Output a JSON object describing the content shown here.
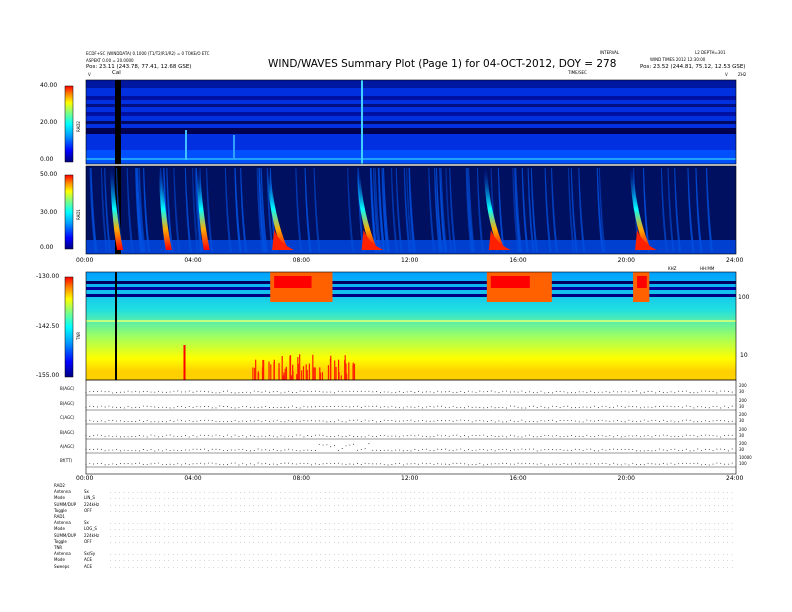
{
  "header": {
    "title": "WIND/WAVES Summary Plot (Page 1) for 04-OCT-2012, DOY = 278",
    "left_line1": "ECDF+SC (WINDDATA) 0.1000 (T1/T2/R1/R2) = 0 TOKE/O ETC",
    "left_line2": "ASPEKT 0.00 = 20.0000",
    "left_line3": "Pos: 23.11 (243.78, 77.41, 12.68 GSE)",
    "center_mark": "Cal",
    "left_v": "V",
    "right_v": "V",
    "right_line1": "INTERVAL",
    "right_line2": "WIND TIMES 2012 12:30:00",
    "right_line3": "Pos: 23.52 (244.81, 75.12, 12.53 GSE)",
    "right_top": "L2 DEPTH=301",
    "right_corner": "ZH2",
    "time_unit": "TIME/SEC"
  },
  "panels": {
    "rad2": {
      "label": "RAD2",
      "ticks": [
        "40.00",
        "20.00",
        "0.00"
      ]
    },
    "rad1": {
      "label": "RAD1",
      "ticks": [
        "50.00",
        "30.00",
        "0.00"
      ]
    },
    "tnr": {
      "label": "TNR",
      "ticks": [
        "-130.00",
        "-142.50",
        "-155.00"
      ],
      "right_ticks": [
        "100",
        "10"
      ],
      "right_unit": "KHZ"
    },
    "time_axis": [
      "00:00",
      "04:00",
      "08:00",
      "12:00",
      "16:00",
      "20:00",
      "24:00"
    ],
    "time_label": "HH:MM"
  },
  "lines": {
    "labels": [
      "B(AGC)",
      "B(AGC)",
      "C(AGC)",
      "B(AGC)",
      "A(AGC)",
      "Bf(TT)"
    ],
    "right_ticks": [
      [
        "200",
        "30"
      ],
      [
        "200",
        "30"
      ],
      [
        "200",
        "30"
      ],
      [
        "200",
        "30"
      ],
      [
        "200",
        "30"
      ],
      [
        "10000",
        "100"
      ]
    ],
    "time_axis": [
      "00:00",
      "04:00",
      "08:00",
      "12:00",
      "16:00",
      "20:00",
      "24:00"
    ]
  },
  "footer": {
    "rows": [
      {
        "k": "RAD2",
        "v": ""
      },
      {
        "k": "Antenna",
        "v": "Sx"
      },
      {
        "k": "Mode",
        "v": "LIN_S"
      },
      {
        "k": "SUMM/DUP",
        "v": "224kHz"
      },
      {
        "k": "Toggle",
        "v": "OFF"
      },
      {
        "k": "RAD1",
        "v": ""
      },
      {
        "k": "Antenna",
        "v": "Sx"
      },
      {
        "k": "Mode",
        "v": "LOG_S"
      },
      {
        "k": "SUMM/DUP",
        "v": "224kHz"
      },
      {
        "k": "Toggle",
        "v": "OFF"
      },
      {
        "k": "TNR",
        "v": ""
      },
      {
        "k": "Antenna",
        "v": "Sx/Sy"
      },
      {
        "k": "Mode",
        "v": "ACE"
      },
      {
        "k": "Sweeps",
        "v": "ACE"
      }
    ]
  },
  "chart_data": {
    "type": "heatmap",
    "title": "WIND/WAVES Summary Plot (Page 1) for 04-OCT-2012, DOY = 278",
    "x_range_hours": [
      0,
      24
    ],
    "bursts_hours": [
      1.0,
      2.8,
      4.2,
      6.8,
      10.1,
      14.8,
      20.2
    ],
    "colorscale": [
      "#000080",
      "#0000ff",
      "#0080ff",
      "#00ffff",
      "#80ff80",
      "#ffff00",
      "#ff8000",
      "#ff0000"
    ]
  }
}
